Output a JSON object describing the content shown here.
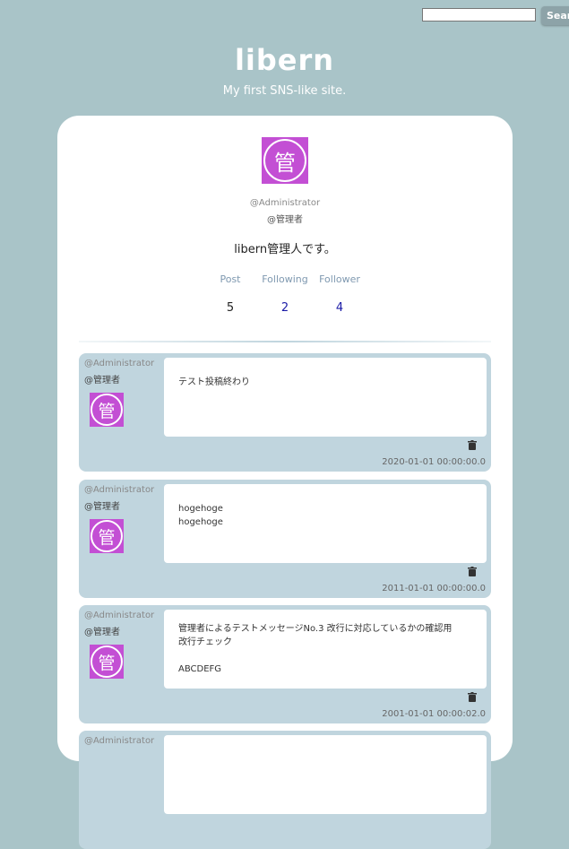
{
  "header": {
    "search_placeholder": "",
    "search_button": "Search",
    "logo": "libern",
    "tagline": "My first SNS-like site."
  },
  "profile": {
    "avatar_char": "管",
    "handle": "@Administrator",
    "name": "@管理者",
    "bio": "libern管理人です。",
    "stats": {
      "post_label": "Post",
      "post_value": "5",
      "following_label": "Following",
      "following_value": "2",
      "follower_label": "Follower",
      "follower_value": "4"
    }
  },
  "posts": [
    {
      "handle": "@Administrator",
      "name": "@管理者",
      "avatar_char": "管",
      "text": "テスト投稿終わり",
      "date": "2020-01-01 00:00:00.0"
    },
    {
      "handle": "@Administrator",
      "name": "@管理者",
      "avatar_char": "管",
      "text": "hogehoge\nhogehoge",
      "date": "2011-01-01 00:00:00.0"
    },
    {
      "handle": "@Administrator",
      "name": "@管理者",
      "avatar_char": "管",
      "text": "管理者によるテストメッセージNo.3 改行に対応しているかの確認用\n改行チェック\n\nABCDEFG",
      "date": "2001-01-01 00:00:02.0"
    },
    {
      "handle": "@Administrator",
      "name": "",
      "avatar_char": "",
      "text": "",
      "date": ""
    }
  ],
  "colors": {
    "background": "#a9c4c8",
    "post_bg": "#c0d5de",
    "avatar": "#c34fd4",
    "link": "#1a1aa6",
    "stat_label": "#7f99b0"
  },
  "icons": {
    "trash": "trash-icon"
  }
}
